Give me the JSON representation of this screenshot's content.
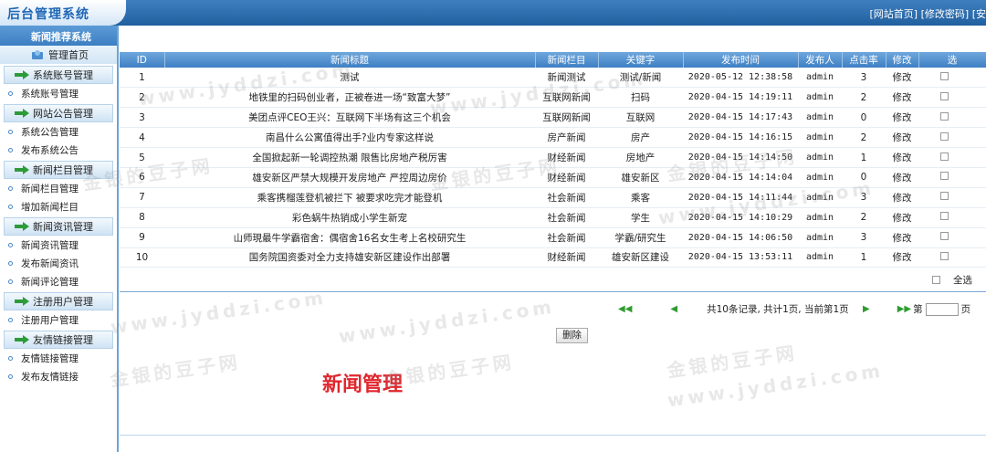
{
  "header": {
    "logo": "后台管理系统",
    "links": [
      "[网站首页]",
      "[修改密码]",
      "[安"
    ]
  },
  "sidebar": {
    "system_title": "新闻推荐系统",
    "home": "管理首页",
    "groups": [
      {
        "title": "系统账号管理",
        "items": [
          "系统账号管理"
        ]
      },
      {
        "title": "网站公告管理",
        "items": [
          "系统公告管理",
          "发布系统公告"
        ]
      },
      {
        "title": "新闻栏目管理",
        "items": [
          "新闻栏目管理",
          "增加新闻栏目"
        ]
      },
      {
        "title": "新闻资讯管理",
        "items": [
          "新闻资讯管理",
          "发布新闻资讯",
          "新闻评论管理"
        ]
      },
      {
        "title": "注册用户管理",
        "items": [
          "注册用户管理"
        ]
      },
      {
        "title": "友情链接管理",
        "items": [
          "友情链接管理",
          "发布友情链接"
        ]
      }
    ]
  },
  "table": {
    "columns": [
      "ID",
      "新闻标题",
      "新闻栏目",
      "关键字",
      "发布时间",
      "发布人",
      "点击率",
      "修改",
      "选"
    ],
    "rows": [
      {
        "id": "1",
        "title": "测试",
        "category": "新闻测试",
        "keyword": "测试/新闻",
        "time": "2020-05-12 12:38:58",
        "author": "admin",
        "clicks": "3",
        "edit": "修改"
      },
      {
        "id": "2",
        "title": "地铁里的扫码创业者，正被卷进一场“致富大梦”",
        "category": "互联网新闻",
        "keyword": "扫码",
        "time": "2020-04-15 14:19:11",
        "author": "admin",
        "clicks": "2",
        "edit": "修改"
      },
      {
        "id": "3",
        "title": "美团点评CEO王兴：互联网下半场有这三个机会",
        "category": "互联网新闻",
        "keyword": "互联网",
        "time": "2020-04-15 14:17:43",
        "author": "admin",
        "clicks": "0",
        "edit": "修改"
      },
      {
        "id": "4",
        "title": "南昌什么公寓值得出手?业内专家这样说",
        "category": "房产新闻",
        "keyword": "房产",
        "time": "2020-04-15 14:16:15",
        "author": "admin",
        "clicks": "2",
        "edit": "修改"
      },
      {
        "id": "5",
        "title": "全国掀起新一轮调控热潮 限售比房地产税厉害",
        "category": "财经新闻",
        "keyword": "房地产",
        "time": "2020-04-15 14:14:50",
        "author": "admin",
        "clicks": "1",
        "edit": "修改"
      },
      {
        "id": "6",
        "title": "雄安新区严禁大规模开发房地产 严控周边房价",
        "category": "财经新闻",
        "keyword": "雄安新区",
        "time": "2020-04-15 14:14:04",
        "author": "admin",
        "clicks": "0",
        "edit": "修改"
      },
      {
        "id": "7",
        "title": "乘客携榴莲登机被拦下 被要求吃完才能登机",
        "category": "社会新闻",
        "keyword": "乘客",
        "time": "2020-04-15 14:11:44",
        "author": "admin",
        "clicks": "3",
        "edit": "修改"
      },
      {
        "id": "8",
        "title": "彩色蜗牛热销成小学生新宠",
        "category": "社会新闻",
        "keyword": "学生",
        "time": "2020-04-15 14:10:29",
        "author": "admin",
        "clicks": "2",
        "edit": "修改"
      },
      {
        "id": "9",
        "title": "山师現最牛学霸宿舍：偶宿舍16名女生考上名校研究生",
        "category": "社会新闻",
        "keyword": "学霸/研究生",
        "time": "2020-04-15 14:06:50",
        "author": "admin",
        "clicks": "3",
        "edit": "修改"
      },
      {
        "id": "10",
        "title": "国务院国资委对全力支持雄安新区建设作出部署",
        "category": "财经新闻",
        "keyword": "雄安新区建设",
        "time": "2020-04-15 13:53:11",
        "author": "admin",
        "clicks": "1",
        "edit": "修改"
      }
    ]
  },
  "select_all": "全选",
  "pager": {
    "summary": "共10条记录, 共计1页, 当前第1页",
    "goto_prefix": "第",
    "goto_suffix": "页"
  },
  "delete_button": "删除",
  "page_heading": "新闻管理",
  "watermark": [
    "金银的豆子网",
    "www.jyddzi.com"
  ],
  "colors": {
    "accent": "#3e7fc3",
    "heading_red": "#e0262d"
  }
}
